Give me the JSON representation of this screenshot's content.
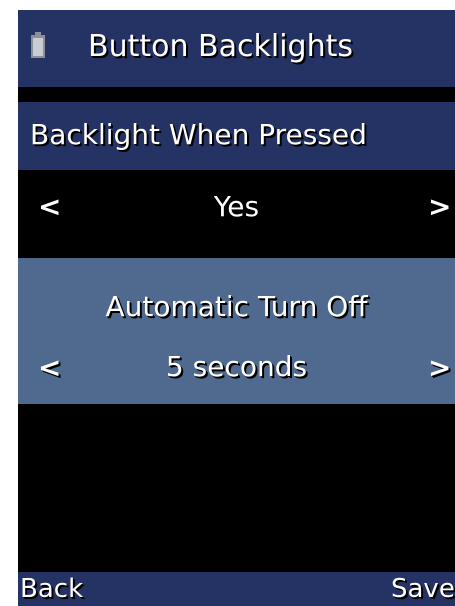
{
  "header": {
    "title": "Button Backlights",
    "icon": "battery-icon"
  },
  "settings": [
    {
      "label": "Backlight When Pressed",
      "value": "Yes",
      "prev_arrow": "<",
      "next_arrow": ">",
      "selected": false
    },
    {
      "label": "Automatic Turn Off",
      "value": "5 seconds",
      "prev_arrow": "<",
      "next_arrow": ">",
      "selected": true
    }
  ],
  "softkeys": {
    "left": "Back",
    "right": "Save"
  },
  "colors": {
    "bar": "#253264",
    "selected_row": "#4f6a8e",
    "background": "#000000",
    "text": "#ffffff"
  }
}
